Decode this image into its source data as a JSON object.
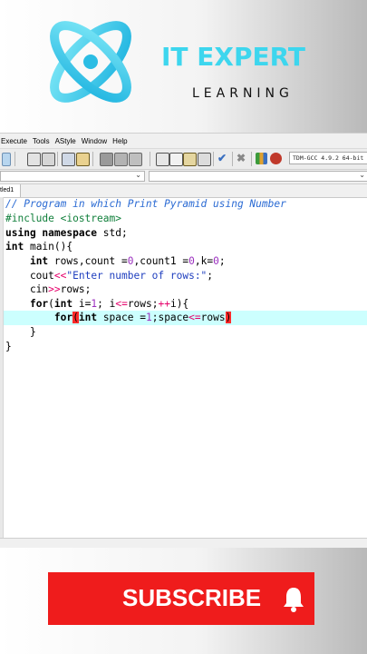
{
  "brand": {
    "title": "IT EXPERT",
    "subtitle": "LEARNING",
    "accent_color": "#3dd6ee"
  },
  "ide": {
    "menu": [
      "Execute",
      "Tools",
      "AStyle",
      "Window",
      "Help"
    ],
    "compiler": "TDM-GCC 4.9.2 64-bit",
    "tab_label": "tled1",
    "toolbar_icons": [
      "compile-icon",
      "run-icon",
      "compile-run-icon",
      "rebuild-icon",
      "debug-icon",
      "back-icon",
      "forward-icon",
      "toggle-icon",
      "grid-icon",
      "window-icon",
      "palette-icon",
      "layout-icon",
      "check-icon",
      "close-icon",
      "chart-icon",
      "profile-icon"
    ],
    "code": [
      "// Program in which Print Pyramid using Number",
      "#include <iostream>",
      "using namespace std;",
      "int main(){",
      "    int rows,count =0,count1 =0,k=0;",
      "    cout<<\"Enter number of rows:\";",
      "    cin>>rows;",
      "    for(int i=1; i<=rows;++i){",
      "        for(int space =1;space<=rows)",
      "    }",
      "}"
    ]
  },
  "subscribe": {
    "label": "SUBSCRIBE",
    "icon": "bell-icon",
    "color": "#ef1c1c"
  }
}
